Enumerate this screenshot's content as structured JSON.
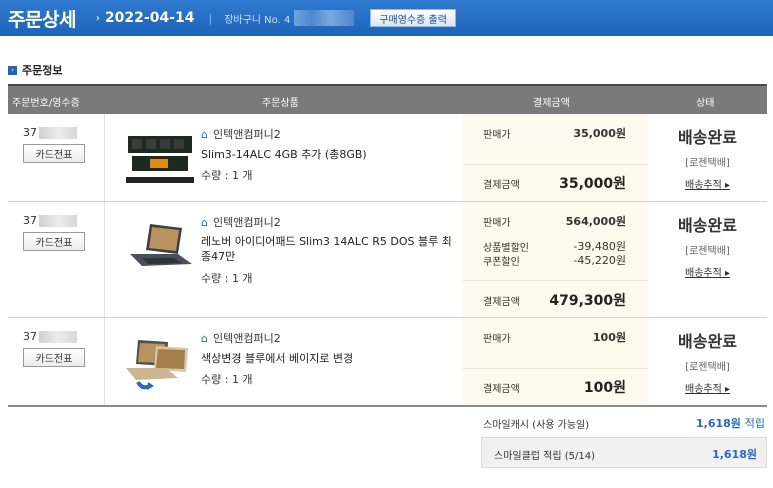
{
  "header": {
    "title": "주문상세",
    "date": "2022-04-14",
    "cart_label": "장바구니 No. 4",
    "receipt_button": "구매영수증 출력"
  },
  "section": {
    "title": "주문정보"
  },
  "table": {
    "headers": [
      "주문번호/영수증",
      "주문상품",
      "결제금액",
      "상태"
    ]
  },
  "orders": [
    {
      "order_no_prefix": "37",
      "card_button": "카드전표",
      "seller": "인텍앤컴퍼니2",
      "product": "Slim3-14ALC 4GB 추가 (총8GB)",
      "quantity": "수량 : 1 개",
      "price_label": "판매가",
      "price": "35,000원",
      "total_label": "결제금액",
      "total": "35,000원",
      "status": "배송완료",
      "courier": "[로젠택배]",
      "track": "배송추적 ▸"
    },
    {
      "order_no_prefix": "37",
      "card_button": "카드전표",
      "seller": "인텍앤컴퍼니2",
      "product": "레노버 아이디어패드 Slim3 14ALC R5 DOS 블루 최종47만",
      "quantity": "수량 : 1 개",
      "price_label": "판매가",
      "price": "564,000원",
      "discount1_label": "상품별할인",
      "discount1": "-39,480원",
      "discount2_label": "쿠폰할인",
      "discount2": "-45,220원",
      "total_label": "결제금액",
      "total": "479,300원",
      "status": "배송완료",
      "courier": "[로젠택배]",
      "track": "배송추적 ▸"
    },
    {
      "order_no_prefix": "37",
      "card_button": "카드전표",
      "seller": "인텍앤컴퍼니2",
      "product": "색상변경 블루에서 베이지로 변경",
      "quantity": "수량 : 1 개",
      "price_label": "판매가",
      "price": "100원",
      "total_label": "결제금액",
      "total": "100원",
      "status": "배송완료",
      "courier": "[로젠택배]",
      "track": "배송추적 ▸"
    }
  ],
  "summary": {
    "smile_cash_label": "스마일캐시 (사용 가능일)",
    "smile_cash_value": "1,618원",
    "smile_cash_unit": "적립",
    "club_label": "스마일클럽 적립 (5/14)",
    "club_value": "1,618원"
  },
  "colors": {
    "header_bg": "#2165b5",
    "accent_blue": "#2868c2",
    "price_bg": "#fffaee"
  }
}
